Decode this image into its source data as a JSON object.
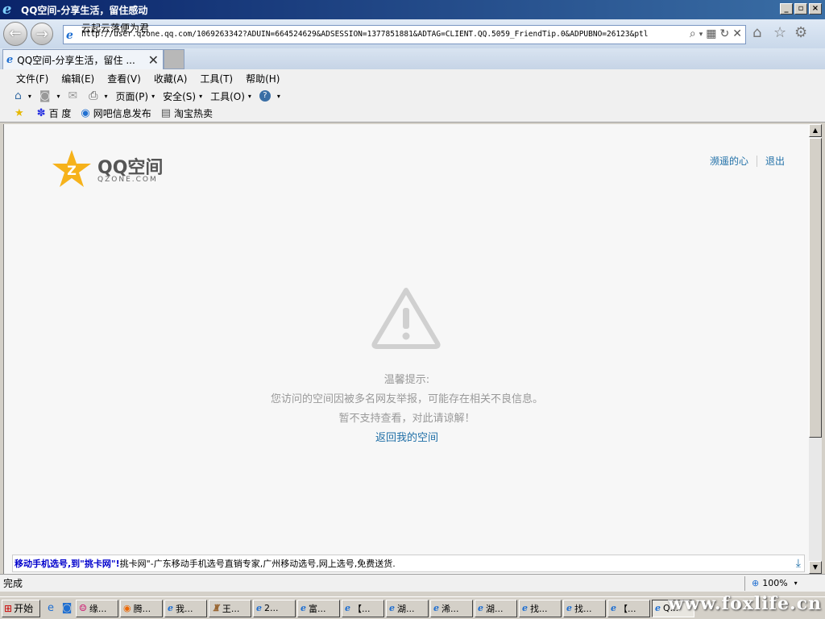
{
  "window": {
    "title": "QQ空间-分享生活，留住感动"
  },
  "address": {
    "url": "http://user.qzone.qq.com/1069263342?ADUIN=664524629&ADSESSION=1377851881&ADTAG=CLIENT.QQ.5059_FriendTip.0&ADPUBNO=26123&ptl",
    "suggestion": "云起云落便为君"
  },
  "tab": {
    "label": "QQ空间-分享生活，留住 ..."
  },
  "menu": [
    "文件(F)",
    "编辑(E)",
    "查看(V)",
    "收藏(A)",
    "工具(T)",
    "帮助(H)"
  ],
  "commands": {
    "page": "页面(P)",
    "safety": "安全(S)",
    "tools": "工具(O)"
  },
  "favorites": [
    "百 度",
    "网吧信息发布",
    "淘宝热卖"
  ],
  "page": {
    "logo_text": "QQ空间",
    "logo_sub": "QZONE.COM",
    "user_link": "濒遥的心",
    "logout": "退出",
    "notice_title": "温馨提示:",
    "notice_line1": "您访问的空间因被多名网友举报，可能存在相关不良信息。",
    "notice_line2": "暂不支持查看，对此请谅解！",
    "back_link": "返回我的空间",
    "ad_title": "移动手机选号,到\"挑卡网\"!",
    "ad_text": "挑卡网\"-广东移动手机选号直销专家,广州移动选号,网上选号,免费送货."
  },
  "status": {
    "text": "完成",
    "zoom": "100%"
  },
  "taskbar": {
    "start": "开始",
    "buttons": [
      "缘...",
      "腾...",
      "我...",
      "王...",
      "2...",
      "富...",
      "【...",
      "湖...",
      "浠...",
      "湖...",
      "找...",
      "找...",
      "【...",
      "Q..."
    ]
  },
  "watermark": "www.foxlife.cn",
  "colors": {
    "link": "#1f6fa7",
    "ad_title": "#0000cc",
    "titlebar": "#0a246a"
  }
}
